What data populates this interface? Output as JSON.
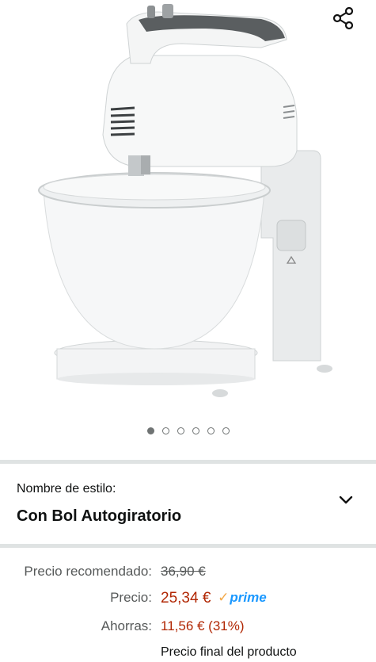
{
  "product": {
    "image_alt": "Batidora amasadora con bol blanco",
    "carousel_count": 6,
    "carousel_active": 1
  },
  "style_selector": {
    "label": "Nombre de estilo:",
    "value": "Con Bol Autogiratorio",
    "icon": "chevron-down-icon"
  },
  "pricing": {
    "recommended_label": "Precio recomendado:",
    "recommended_value": "36,90 €",
    "price_label": "Precio:",
    "price_value": "25,34 €",
    "prime_badge": "prime",
    "savings_label": "Ahorras:",
    "savings_value": "11,56 € (31%)",
    "final_note": "Precio final del producto"
  },
  "icons": {
    "share": "share-icon"
  }
}
